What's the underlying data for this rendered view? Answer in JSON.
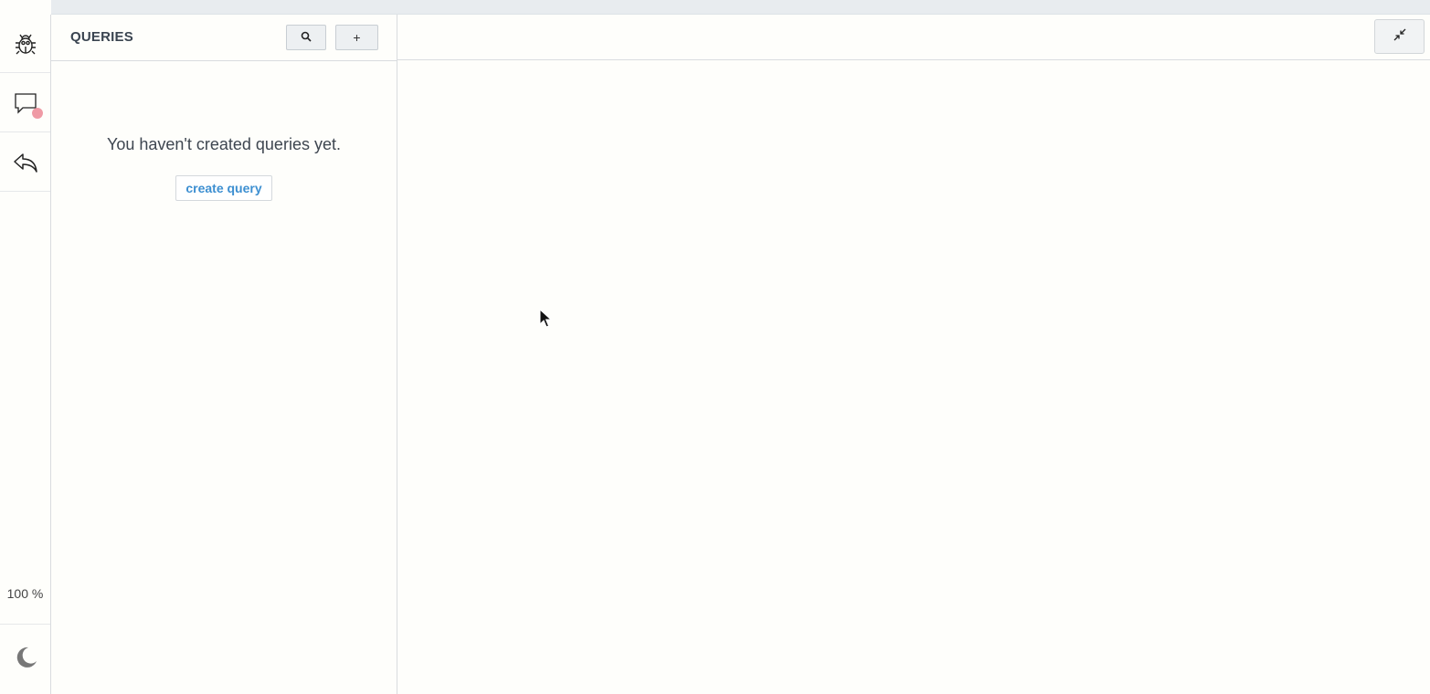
{
  "panel": {
    "title": "QUERIES",
    "search_button": "search-icon",
    "add_button_label": "+",
    "empty_message": "You haven't created queries yet.",
    "create_button_label": "create query"
  },
  "rail": {
    "items": [
      {
        "icon": "bug-icon"
      },
      {
        "icon": "chat-icon",
        "badge_color": "#ef9aa5"
      },
      {
        "icon": "reply-icon"
      }
    ],
    "zoom": "100 %",
    "theme_icon": "moon-icon"
  },
  "main": {
    "collapse_icon": "minimize-icon"
  },
  "colors": {
    "accent": "#3d8fd1",
    "background": "#fefefb",
    "badge": "#ef9aa5"
  }
}
